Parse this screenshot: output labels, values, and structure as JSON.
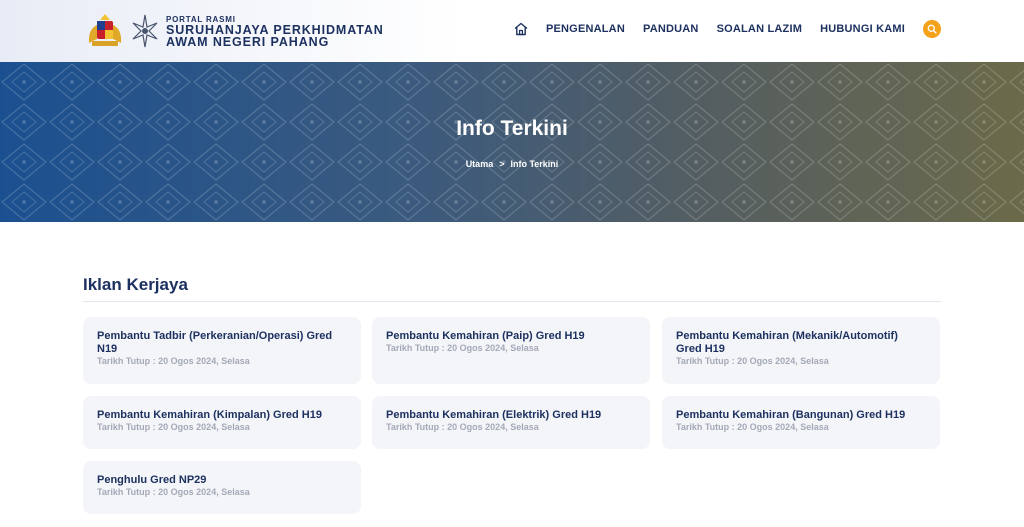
{
  "brand": {
    "small": "PORTAL RASMI",
    "line1": "SURUHANJAYA PERKHIDMATAN",
    "line2": "AWAM NEGERI PAHANG"
  },
  "nav": {
    "home_icon": "home-icon",
    "items": [
      "PENGENALAN",
      "PANDUAN",
      "SOALAN LAZIM",
      "HUBUNGI KAMI"
    ],
    "search_icon": "search-icon",
    "accent": "#f5a21b"
  },
  "hero": {
    "title": "Info Terkini",
    "breadcrumb": [
      "Utama",
      ">",
      "Info Terkini"
    ]
  },
  "section": {
    "title": "Iklan Kerjaya"
  },
  "jobs": [
    {
      "title": "Pembantu Tadbir (Perkeranian/Operasi) Gred N19",
      "date": "Tarikh Tutup : 20 Ogos 2024, Selasa"
    },
    {
      "title": "Pembantu Kemahiran (Paip) Gred H19",
      "date": "Tarikh Tutup : 20 Ogos 2024, Selasa"
    },
    {
      "title": "Pembantu Kemahiran (Mekanik/Automotif) Gred H19",
      "date": "Tarikh Tutup : 20 Ogos 2024, Selasa"
    },
    {
      "title": "Pembantu Kemahiran (Kimpalan) Gred H19",
      "date": "Tarikh Tutup : 20 Ogos 2024, Selasa"
    },
    {
      "title": "Pembantu Kemahiran (Elektrik) Gred H19",
      "date": "Tarikh Tutup : 20 Ogos 2024, Selasa"
    },
    {
      "title": "Pembantu Kemahiran (Bangunan) Gred H19",
      "date": "Tarikh Tutup : 20 Ogos 2024, Selasa"
    },
    {
      "title": "Penghulu Gred NP29",
      "date": "Tarikh Tutup : 20 Ogos 2024, Selasa"
    }
  ]
}
